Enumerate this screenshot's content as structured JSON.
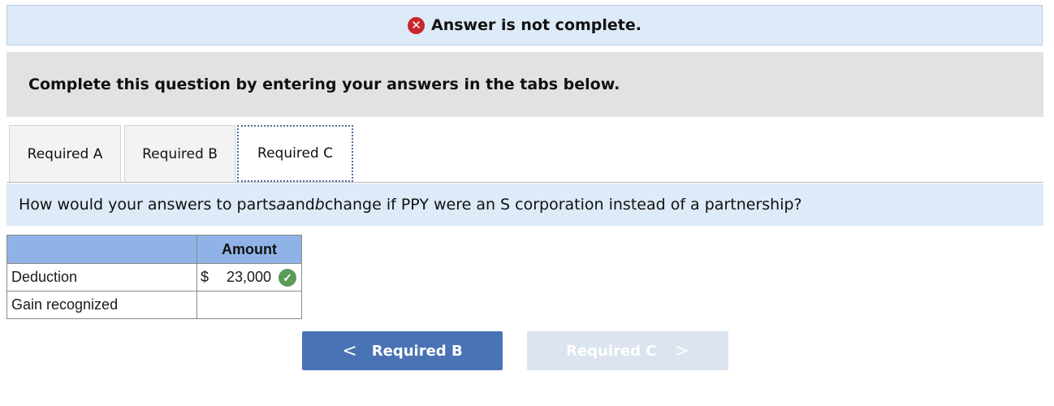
{
  "banner": {
    "status_text": "Answer is not complete.",
    "icon": "x-circle-icon",
    "icon_glyph": "✕",
    "icon_color": "#c8272d"
  },
  "instruction": "Complete this question by entering your answers in the tabs below.",
  "tabs": [
    {
      "label": "Required A",
      "active": false
    },
    {
      "label": "Required B",
      "active": false
    },
    {
      "label": "Required C",
      "active": true
    }
  ],
  "question": {
    "part1": "How would your answers to parts ",
    "a": "a",
    "part2": " and ",
    "b": "b",
    "part3": " change if PPY were an S corporation instead of a partnership?"
  },
  "table": {
    "header_amount": "Amount",
    "rows": [
      {
        "label": "Deduction",
        "currency": "$",
        "value": "23,000",
        "correct": true
      },
      {
        "label": "Gain recognized",
        "currency": "",
        "value": "",
        "correct": false
      }
    ]
  },
  "nav": {
    "prev_label": "Required B",
    "prev_chevron": "<",
    "next_label": "Required C",
    "next_chevron": ">",
    "prev_color": "#4a73b5",
    "next_color": "#dbe4ef"
  },
  "check_glyph": "✓",
  "check_color": "#5b9b58"
}
